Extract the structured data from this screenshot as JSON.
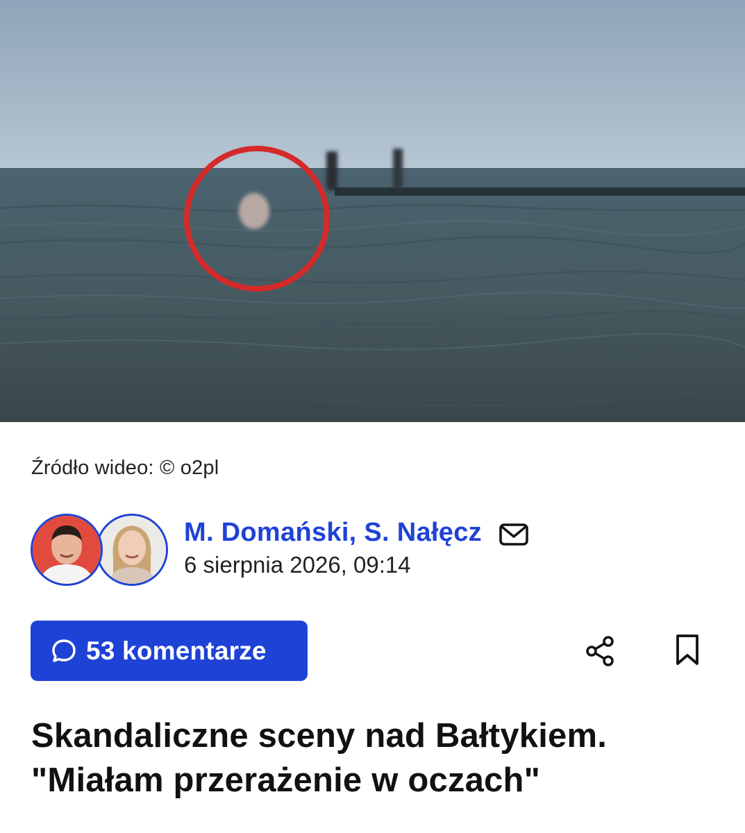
{
  "video": {
    "source_label": "Źródło wideo: © o2pl"
  },
  "article": {
    "authors": "M. Domański, S. Nałęcz",
    "date": "6 sierpnia 2026, 09:14",
    "headline": "Skandaliczne sceny nad Bałtykiem. \"Miałam przerażenie w oczach\""
  },
  "actions": {
    "comments_label": "53 komentarze",
    "share_icon": "share-icon",
    "bookmark_icon": "bookmark-icon",
    "mail_icon": "mail-icon"
  },
  "colors": {
    "accent": "#1f42d6",
    "highlight_circle": "#d42a2a"
  }
}
